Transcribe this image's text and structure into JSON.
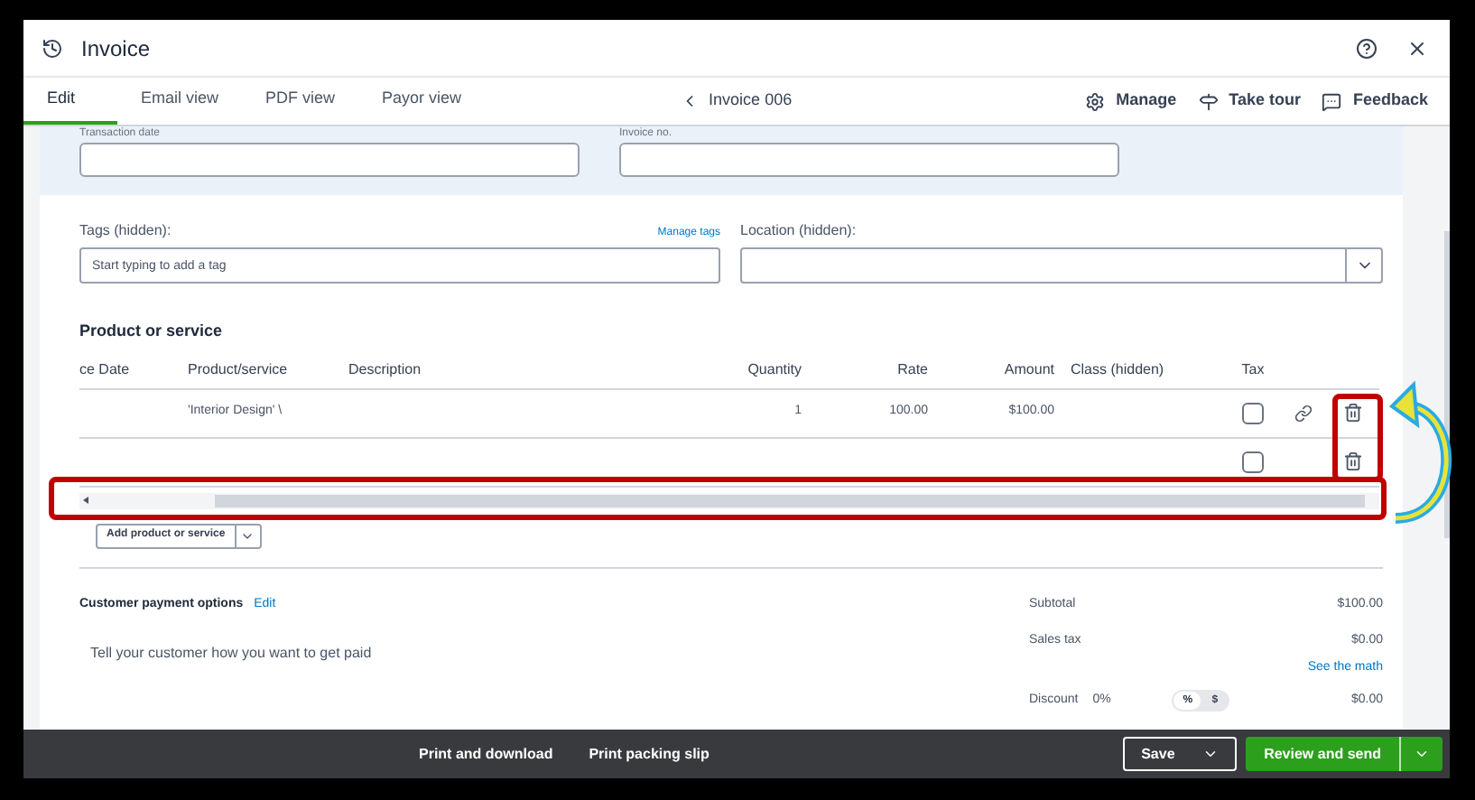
{
  "window": {
    "title": "Invoice"
  },
  "tabs": [
    {
      "label": "Edit",
      "selected": true
    },
    {
      "label": "Email view",
      "selected": false
    },
    {
      "label": "PDF view",
      "selected": false
    },
    {
      "label": "Payor view",
      "selected": false
    }
  ],
  "invoice_nav": {
    "label": "Invoice 006"
  },
  "toolbar_actions": [
    {
      "label": "Manage",
      "kind": "gear"
    },
    {
      "label": "Take tour",
      "kind": "signpost"
    },
    {
      "label": "Feedback",
      "kind": "chat"
    }
  ],
  "fields": {
    "transaction_date": {
      "label": "Transaction date"
    },
    "invoice_no": {
      "label": "Invoice no."
    },
    "tags": {
      "label": "Tags (hidden):",
      "link": "Manage tags",
      "placeholder": "Start typing to add a tag"
    },
    "location": {
      "label": "Location (hidden):"
    }
  },
  "products": {
    "title": "Product or service",
    "columns": [
      "ce Date",
      "Product/service",
      "Description",
      "Quantity",
      "Rate",
      "Amount",
      "Class (hidden)",
      "Tax"
    ],
    "rows": [
      {
        "product": "'Interior Design' \\",
        "quantity": "1",
        "rate": "100.00",
        "amount": "$100.00",
        "tax_checked": false,
        "linked": true
      },
      {
        "tax_checked": false,
        "linked": false
      }
    ],
    "add_button": "Add product or service"
  },
  "payment": {
    "title": "Customer payment options",
    "link": "Edit",
    "prompt": "Tell your customer how you want to get paid"
  },
  "totals": {
    "subtotal": {
      "label": "Subtotal",
      "value": "$100.00"
    },
    "sales_tax": {
      "label": "Sales tax",
      "value": "$0.00"
    },
    "see_math": "See the math",
    "discount": {
      "label": "Discount",
      "rate": "0%",
      "options": [
        {
          "label": "%",
          "selected": true
        },
        {
          "label": "$",
          "selected": false
        }
      ],
      "value": "$0.00"
    }
  },
  "footer": {
    "actions": [
      "Print and download",
      "Print packing slip"
    ],
    "save": "Save",
    "primary": "Review and send"
  }
}
